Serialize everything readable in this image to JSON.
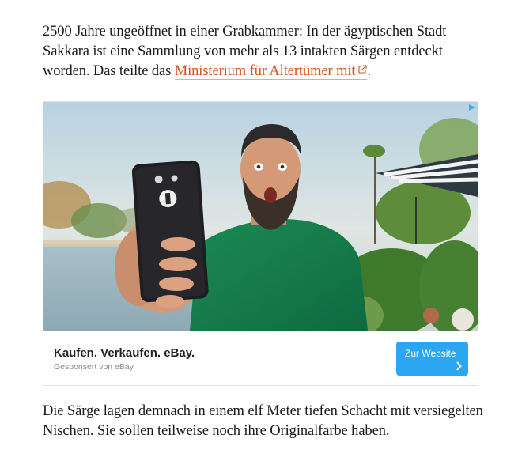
{
  "article": {
    "para1_text": "2500 Jahre ungeöffnet in einer Grabkammer: In der ägyptischen Stadt Sakkara ist eine Sammlung von mehr als 13 intakten Särgen entdeckt worden. Das teilte das ",
    "para1_link": "Ministerium für Altertümer mit",
    "para1_end": ".",
    "para2_text": "Die Särge lagen demnach in einem elf Meter tiefen Schacht mit versiegelten Nischen. Sie sollen teilweise noch ihre Originalfarbe haben."
  },
  "ad": {
    "title": "Kaufen. Verkaufen. eBay.",
    "sponsor": "Gesponsert von eBay",
    "cta_label": "Zur Website",
    "cta_color": "#2aa6f3"
  },
  "colors": {
    "link": "#d2521f",
    "text": "#1a1a1a"
  }
}
